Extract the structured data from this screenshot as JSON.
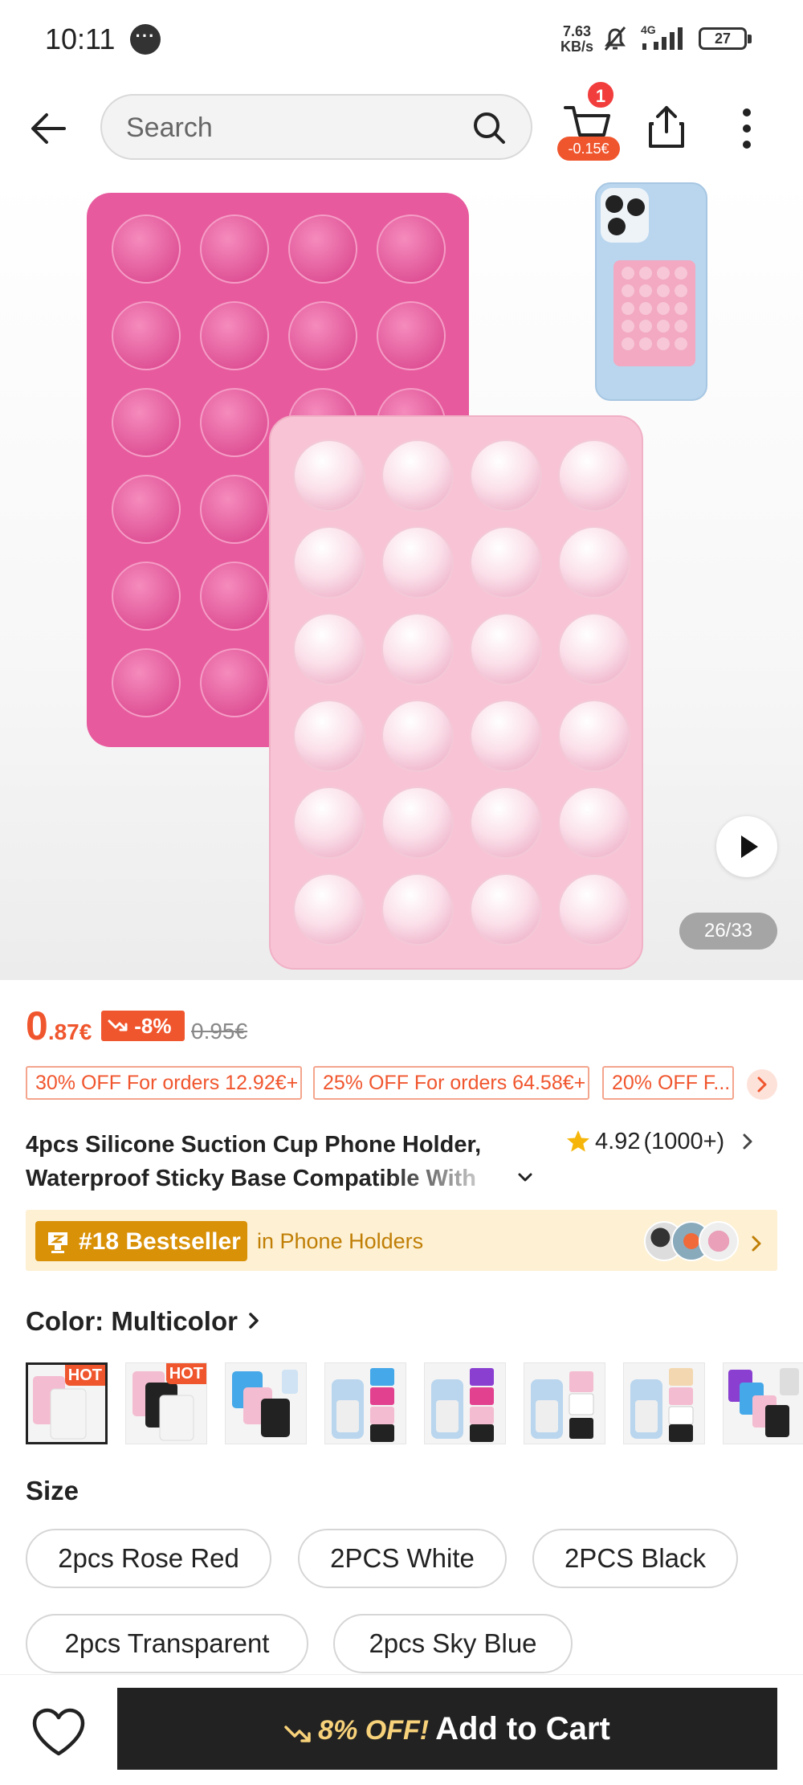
{
  "status_bar": {
    "time": "10:11",
    "net_speed_value": "7.63",
    "net_speed_unit": "KB/s",
    "network_type": "4G",
    "battery": "27"
  },
  "nav": {
    "search_placeholder": "Search",
    "cart_count": "1",
    "cart_discount": "-0.15€"
  },
  "gallery": {
    "image_counter": "26/33"
  },
  "price": {
    "current_int": "0",
    "current_dec": ".87€",
    "discount_pct": "-8%",
    "original": "0.95€"
  },
  "coupons": [
    {
      "label": "30% OFF For orders 12.92€+"
    },
    {
      "label": "25% OFF For orders 64.58€+"
    },
    {
      "label": "20% OFF F..."
    }
  ],
  "product": {
    "title_line1": "4pcs Silicone Suction Cup Phone Holder,",
    "title_line2": "Waterproof Sticky Base Compatible With",
    "rating": "4.92",
    "rating_count": "(1000+)"
  },
  "bestseller": {
    "rank": "#18 Bestseller",
    "category": "in Phone Holders"
  },
  "color": {
    "label": "Color: ",
    "value": "Multicolor",
    "hot_badge": "HOT"
  },
  "size": {
    "label": "Size",
    "options": [
      "2pcs Rose Red",
      "2PCS White",
      "2PCS Black",
      "2pcs Transparent",
      "2pcs Sky Blue"
    ]
  },
  "bottom": {
    "discount": "8% OFF!",
    "add_to_cart": "Add to Cart"
  },
  "colors": {
    "accent_orange": "#f0562e",
    "bestseller_gold": "#d99108",
    "bestseller_bg": "#fdf0d3",
    "cta_dark": "#222222",
    "cta_discount": "#f8d27a"
  }
}
